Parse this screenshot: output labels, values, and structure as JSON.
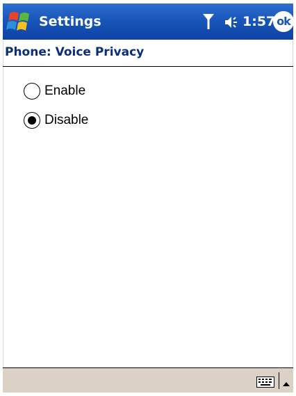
{
  "titlebar": {
    "app_title": "Settings",
    "clock": "1:57",
    "ok_label": "ok",
    "icons": [
      "windows-start-icon",
      "signal-antenna-icon",
      "speaker-volume-icon"
    ],
    "background_color": "#1956bb"
  },
  "page": {
    "title": "Phone: Voice Privacy",
    "title_color": "#0a2e7a"
  },
  "options": [
    {
      "label": "Enable",
      "selected": false
    },
    {
      "label": "Disable",
      "selected": true
    }
  ],
  "menubar": {
    "background_color": "#dbd2c5",
    "icons": [
      "keyboard-icon",
      "sip-arrow-up-icon"
    ]
  }
}
